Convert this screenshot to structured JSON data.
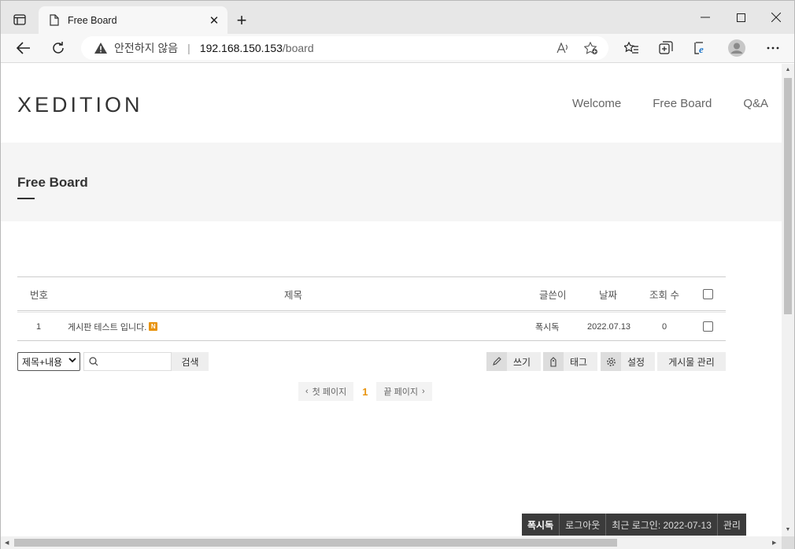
{
  "browser": {
    "tab_title": "Free Board",
    "security_label": "안전하지 않음",
    "url_host": "192.168.150.153",
    "url_path": "/board"
  },
  "site": {
    "logo": "XEDITION",
    "nav": [
      "Welcome",
      "Free Board",
      "Q&A"
    ]
  },
  "page": {
    "title": "Free Board"
  },
  "board": {
    "columns": {
      "no": "번호",
      "title": "제목",
      "author": "글쓴이",
      "date": "날짜",
      "views": "조회 수"
    },
    "rows": [
      {
        "no": "1",
        "title": "게시판 테스트 입니다.",
        "badge": "N",
        "author": "폭시독",
        "date": "2022.07.13",
        "views": "0"
      }
    ]
  },
  "search": {
    "select_value": "제목+내용",
    "button": "검색"
  },
  "actions": {
    "write": "쓰기",
    "tag": "태그",
    "settings": "설정",
    "manage": "게시물 관리"
  },
  "pager": {
    "first": "첫 페이지",
    "current": "1",
    "last": "끝 페이지"
  },
  "status_bar": {
    "user": "폭시독",
    "logout": "로그아웃",
    "last_login": "최근 로그인: 2022-07-13",
    "admin": "관리"
  }
}
